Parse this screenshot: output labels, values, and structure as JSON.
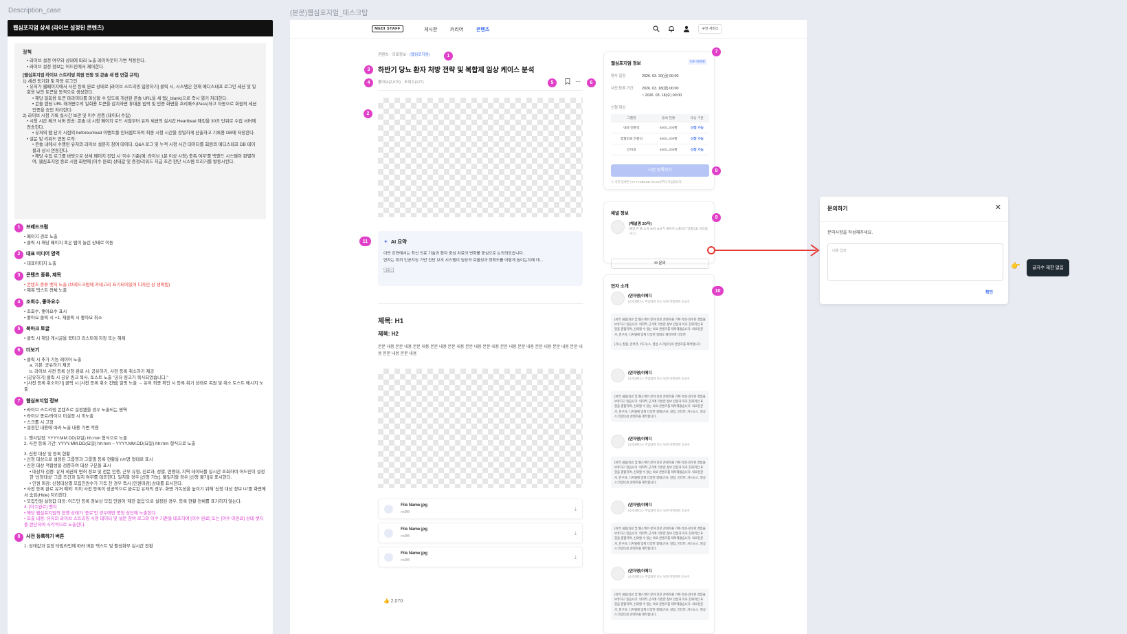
{
  "canvas": {
    "left_label": "Description_case",
    "right_label": "(본문)웹심포지엄_데스크탑"
  },
  "desc": {
    "header": "웹심포지엄 상세 (라이브 설정된 콘텐츠)",
    "policy": {
      "title": "정책",
      "lines": [
        {
          "c": "i1",
          "t": "• 라이브 설정 여부와 상태에 따라 노출 레이아웃이 가변 적용된다."
        },
        {
          "c": "i1",
          "t": "• 라이브 설정 정보는 어드민에서 제어한다."
        },
        {
          "c": "ps",
          "t": "[웹심포지엄 라이브 스트리밍 회원 연동 및 콘솔 새 탭 연결 규칙]"
        },
        {
          "c": "",
          "t": "1) 세션 동기화 및 자동 로그인"
        },
        {
          "c": "i1",
          "t": "• 유저가 웹페이지에서 사전 등록 완료 상태로 [라이브 스트리밍 입장하기] 클릭 시, 시스템은 현재 메디스태프 로그인 세션 및 일회용 보안 토큰을 동적으로 생성한다."
        },
        {
          "c": "i2",
          "t": "• 해당 일회용 토큰 파라미터를 파싱할 수 있도록 개선된 콘솔 URL을 새 탭(_blank)으로 즉시 열기 처리한다."
        },
        {
          "c": "i2",
          "t": "• 콘솔 랜딩 URL 매개변수의 일회용 토큰을 감지하면 휴대폰 입력 및 인증 화면을 프리패스(Pass)하고 자동으로 회원의 세션 인증을 승인 처리한다."
        },
        {
          "c": "",
          "t": "2) 라이브 시청 기록 실시간 보관 및 이수 검증 (데이터 수집)"
        },
        {
          "c": "i1",
          "t": "• 시청 시간 체크 서버 전송: 콘솔 내 시청 페이지 로드 시점부터 유저 세션의 실시간 Heartbeat 패킷을 30초 단위로 수집 서버에 전송한다."
        },
        {
          "c": "i2",
          "t": "• 유저의 탭 닫기 시점의 beforeunload 이벤트를 인터셉트하여 최종 시청 시간을 정밀하게 산출하고 기록용 DB에 저장한다."
        },
        {
          "c": "i1",
          "t": "• 설문 및 리워드 연동 로직:"
        },
        {
          "c": "i2",
          "t": "• 콘솔 내에서 수행된 유저의 라이브 설문지 참여 데이터, Q&A 로그 및 누적 시청 시간 데이터를 회원의 메디스태프 DB 테이블과 상시 연동한다."
        },
        {
          "c": "i2",
          "t": "• 해당 수집 로그를 바탕으로 상세 페이지 진입 시 '이수 기준(예: 라이브 1분 이상 시청) 충족 여부'를 백엔드 시스템이 판별하여, 웹심포지엄 종료 시점 화면에 [이수 완료] 상태값 및 증정/리워드 지급 조건 판단 시스템 트리거를 발동시킨다."
        }
      ]
    },
    "sections": [
      {
        "n": "1",
        "title": "브레드크럼",
        "lines": [
          {
            "c": "b",
            "t": "• 페이지 경로 노출"
          },
          {
            "c": "b",
            "t": "• 클릭 시 해당 페이지 혹은 탭이 눌린 상태로 이동"
          }
        ]
      },
      {
        "n": "2",
        "title": "대표 미디어 영역",
        "lines": [
          {
            "c": "b",
            "t": "• 대표이미지 노출"
          }
        ]
      },
      {
        "n": "3",
        "title": "콘텐츠 종류, 제목",
        "lines": [
          {
            "c": "b red",
            "t": "• 콘텐츠 종류 뱃지 노출 (브레드크럼에 카테고리 표기되어있어 디자인 상 생략됨)"
          },
          {
            "c": "b",
            "t": "• 제목 텍스트 전체 노출"
          }
        ]
      },
      {
        "n": "4",
        "title": "조회수, 좋아요수",
        "lines": [
          {
            "c": "b",
            "t": "• 조회수, 좋아요수 표시"
          },
          {
            "c": "b",
            "t": "• 좋아요 클릭 시 +1, 재클릭 시 좋아요 취소"
          }
        ]
      },
      {
        "n": "5",
        "title": "북마크 토글",
        "lines": [
          {
            "c": "b",
            "t": "• 클릭 시 해당 게시글을 북마크 리스트에 저장 또는 해제"
          }
        ]
      },
      {
        "n": "6",
        "title": "더보기",
        "lines": [
          {
            "c": "b",
            "t": "• 클릭 시 추가 기능 레이어 노출"
          },
          {
            "c": "b2",
            "t": "a. 기본: 공유하기 제공"
          },
          {
            "c": "b2",
            "t": "b. 라이브 사전 등록 신청 완료 시: 공유하기, 사전 등록 취소하기 제공"
          },
          {
            "c": "b",
            "t": "• [공유하기] 클릭 시 공유 링크 복사, 토스트 노출 \"공유 링크가 복사되었습니다.\""
          },
          {
            "c": "b",
            "t": "• [사전 등록 취소하기] 클릭 시 [사전 등록 취소 컨펌] 얼럿 노출 → 유저 최종 확인 시 등록 취기 상태로 복원 및 취소 토스트 메시지 노출"
          }
        ]
      },
      {
        "n": "7",
        "title": "웹심포지엄 정보",
        "lines": [
          {
            "c": "b",
            "t": "• 라이브 스트리밍 콘텐츠로 설정됐을 경우 노출되는 영역"
          },
          {
            "c": "b",
            "t": "• 라이브 종료/라이브 미설정 시 미노출"
          },
          {
            "c": "b",
            "t": "• 스크롤 시 고정"
          },
          {
            "c": "b",
            "t": "• 설정한 내용에 따라 노출 내용 가변 적용"
          },
          {
            "c": "gap",
            "t": ""
          },
          {
            "c": "b",
            "t": "1. 행사일정: YYYY.MM.DD(요일) hh:mm 형식으로 노출"
          },
          {
            "c": "b",
            "t": "2. 사전 등록 기간: YYYY.MM.DD(요일) hh:mm ~ YYYY.MM.DD(요일) hh:mm 형식으로 노출"
          },
          {
            "c": "gap",
            "t": ""
          },
          {
            "c": "b",
            "t": "3. 신청 대상 및 등록 현황"
          },
          {
            "c": "b",
            "t": "• 신청 대상으로 설정된 그룹명과 그룹별 등록 현황을 n/n명 형태로 표시"
          },
          {
            "c": "b",
            "t": "• 신청 대상 적합성을 검증하여 대상 구분을 표시"
          },
          {
            "c": "b2",
            "t": "• 대상자 검증: 유저 세션의 면허 정보 및 전문 인증, 근무 유형, 진료과, 성별, 연령대, 지역 데이터를 실시간 조회하여 어드민이 설정한 '신청대상' 그룹 조건과 일치 여부를 대조한다. 일치할 경우 [신청 가능], 불일치할 경우 [신청 불가]로 표시한다."
          },
          {
            "c": "b2",
            "t": "• 인원 마감: 신청대상별 모집인원수가 가득 찬 경우 즉시 [인원마감] 상태를 표시한다."
          },
          {
            "c": "b",
            "t": "• 사전 등록 완료 유저 예외: 이미 사전 등록이 성공적으로 완료된 유저의 경우, 화면 가독성을 높이기 위해 '신청 대상 정보 UI'를 화면에서 숨김(Hide) 처리한다."
          },
          {
            "c": "b",
            "t": "• 모집인원 설정값 대응: 어드민 등록 정보상 모집 인원이 '제한 없음'으로 설정된 경우, 등록 현황 전체를 표기하지 않는다."
          },
          {
            "c": "b pink",
            "t": "4. [이수완료] 뱃지"
          },
          {
            "c": "b pink",
            "t": "• 해당 웹심포지엄의 현행 상태가 '종료'인 경우에만 명칭 상단에 노출한다."
          },
          {
            "c": "b pink",
            "t": "• 호출 내용: 유저의 라이브 스트리밍 시청 데이터 및 설문 참여 로그와 이수 기준을 대조하여 [이수 완료] 또는 [이수 미완료] 상태 뱃지를 판단하여 시각적으로 노출한다."
          }
        ]
      },
      {
        "n": "8",
        "title": "사전 등록하기 버튼",
        "lines": [
          {
            "c": "b",
            "t": "1. 상태값과 일정 타임라인에 따라 버튼 텍스트 및 활성화부 실시간 전환"
          }
        ]
      }
    ]
  },
  "desk": {
    "logo": "MEDI STAFF",
    "nav": [
      "게시판",
      "커리어",
      "콘텐츠"
    ],
    "nav_active": "콘텐츠",
    "service_btn": "구인 서비스",
    "breadcrumb": [
      "콘텐츠",
      "의료정보",
      "(웹심포지엄)"
    ],
    "title": "하반기 당뇨 환자 처방 전략 및 복합제 임상 케이스 분석",
    "meta": "좋아요(2,070) · 조회수(127)",
    "ai": {
      "title": "AI 요약",
      "desc1": "이번 강연에서는 최신 의료 기술과 환자 중심 치료의 변화를 중심으로 논의되었습니다.",
      "desc2": "연자는 특히 인공지능 기반 진단 보조 시스템이 임상의 효율성과 정확도를 어떻게 높이는지에 대...",
      "more": "더보기"
    },
    "h1": "제목: H1",
    "h2": "제목: H2",
    "body": "본문 내용 본문 내용 본문 내용 본문 내용 본문 내용 본문 내용 본문 내용 본문 내용 본문 내용 본문 내용 본문 내용 본문 내용 본문 내용 본문 내용",
    "files": [
      {
        "name": "File Name.jpg",
        "size": "nnMB"
      },
      {
        "name": "File Name.jpg",
        "size": "nnMB"
      },
      {
        "name": "File Name.jpg",
        "size": "nnMB"
      }
    ],
    "likes": "2,070",
    "info": {
      "title": "웹심포지엄 정보",
      "tag": "이수 미완료",
      "event_label": "행사 일정",
      "event_value": "2026. 03. 20(금) 00:00",
      "reg_label": "사전 등록 기간",
      "reg_value1": "2026. 03. 18(금) 00:00",
      "reg_value2": "~ 2026. 03. 18(수) 00:00",
      "target_label": "신청 대상",
      "cols": [
        "그룹명",
        "등록 현황",
        "대상 구분"
      ],
      "rows": [
        [
          "내과 전문의",
          "400/1,200명",
          "신청 가능"
        ],
        [
          "정형외과 전문의",
          "400/1,200명",
          "신청 가능"
        ],
        [
          "간이과",
          "400/1,200명",
          "신청 가능"
        ]
      ],
      "btn": "사전 등록하기",
      "note": "ⓘ 사전 등록은 (YYYY.MM.DD hh:mm)부터 가능합니다."
    },
    "channel": {
      "title": "채널 정보",
      "name": "(채널명 20자)",
      "desc": "(채널 한 줄 소개 40자 and 두 줄까지 노출되고 말줄임표 처리됩니다.)",
      "btn": "✉ 문의"
    },
    "speakers": {
      "title": "연자 소개",
      "name": "(연자명)이메디",
      "sub": "(소속)메디스 주임대학 또는 보낸 어떤대학 조교수",
      "bio": "(이력 내용)의료 및 헬스케어 분야 전문 콘텐츠를 기획·작성·검수한 경험을 보유하고 있습니다. 의학적 근거에 기반한 정보 전달과 독자 친화적인 표현을 결합하여, 신뢰할 수 있는 의료 콘텐츠를 제작해왔습니다. 의료전문가, 연구자, 디지털에 맞춰 다양한 형태(기사, 칼럼, 인터뷰, 카드뉴스, 영상 스크립트)의 콘텐츠를 제작합니다.",
      "bio_short": "(이력 내용)의료 및 헬스케어 분야 전문 콘텐츠를 기획·작성·검수한 경험을 보유하고 있습니다. 의학적 근거에 기반한 정보 전달과 독자 친화적인 표현을 결합하여, 신뢰할 수 있는 의료 콘텐츠를 제작해왔습니다. 의료전문가, 연구자, 디지털에 맞춰 다양한 형태로 제작하여 다양한",
      "bio_short2": "(기사, 칼럼, 인터뷰, 카드뉴스, 영상 스크립트)의 콘텐츠를 제작합니다."
    }
  },
  "dialog": {
    "title": "문의하기",
    "label": "문의사항을 작성해주세요.",
    "placeholder": "내용 입력",
    "confirm": "확인"
  },
  "tooltip": "글자수 제한 없음",
  "markers": [
    "1",
    "2",
    "3",
    "4",
    "5",
    "6",
    "7",
    "8",
    "9",
    "10",
    "11"
  ],
  "colors": {
    "accent": "#3b6cf0",
    "marker": "#e040c8",
    "arrow": "#e53935"
  }
}
